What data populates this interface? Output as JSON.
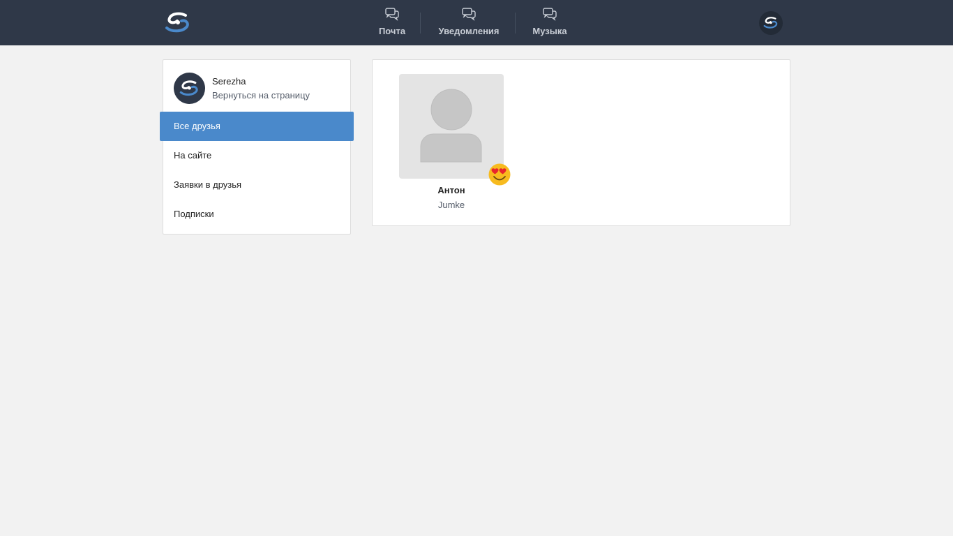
{
  "header": {
    "logo_icon": "site-logo-icon",
    "nav": [
      {
        "label": "Почта",
        "icon": "chat-bubbles-icon"
      },
      {
        "label": "Уведомления",
        "icon": "chat-bubbles-icon"
      },
      {
        "label": "Музыка",
        "icon": "chat-bubbles-icon"
      }
    ],
    "avatar_icon": "user-avatar-icon"
  },
  "sidebar": {
    "profile": {
      "name": "Serezha",
      "back_link": "Вернуться на страницу"
    },
    "menu": [
      {
        "label": "Все друзья",
        "active": true
      },
      {
        "label": "На сайте",
        "active": false
      },
      {
        "label": "Заявки в друзья",
        "active": false
      },
      {
        "label": "Подписки",
        "active": false
      }
    ]
  },
  "friends": [
    {
      "name": "Антон",
      "subtitle": "Jumke",
      "photo_icon": "default-user-silhouette-icon",
      "status_emoji_icon": "heart-eyes-emoji-icon"
    }
  ],
  "colors": {
    "header_bg": "#2f3848",
    "page_bg": "#f2f2f2",
    "accent": "#4a89cb",
    "logo_blue": "#4a89cb"
  }
}
